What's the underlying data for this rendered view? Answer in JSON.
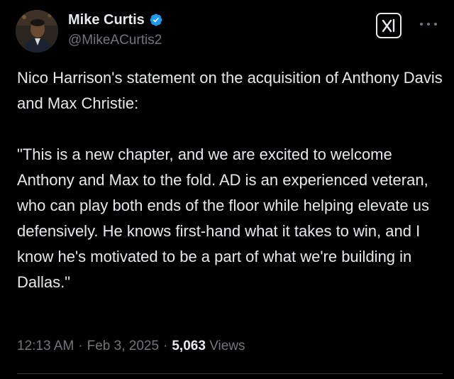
{
  "author": {
    "display_name": "Mike Curtis",
    "handle": "@MikeACurtis2",
    "verified": true
  },
  "tweet": {
    "paragraphs": [
      "Nico Harrison's statement on the acquisition of Anthony Davis and Max Christie:",
      "\"This is a new chapter, and we are excited to welcome Anthony and Max to the fold. AD is an experienced veteran, who can play both ends of the floor while helping elevate us defensively. He knows first-hand what it takes to win, and I know he's motivated to be a part of what we're building in Dallas.\""
    ],
    "time": "12:13 AM",
    "date": "Feb 3, 2025",
    "separator": "·",
    "views_count": "5,063",
    "views_label": "Views"
  },
  "icons": {
    "verified": "verified-badge-icon",
    "grok": "grok-icon",
    "more": "more-options-icon"
  },
  "colors": {
    "background": "#000000",
    "text": "#e7e9ea",
    "secondary_text": "#71767b",
    "verified_blue": "#1d9bf0",
    "divider": "#2f3336"
  }
}
